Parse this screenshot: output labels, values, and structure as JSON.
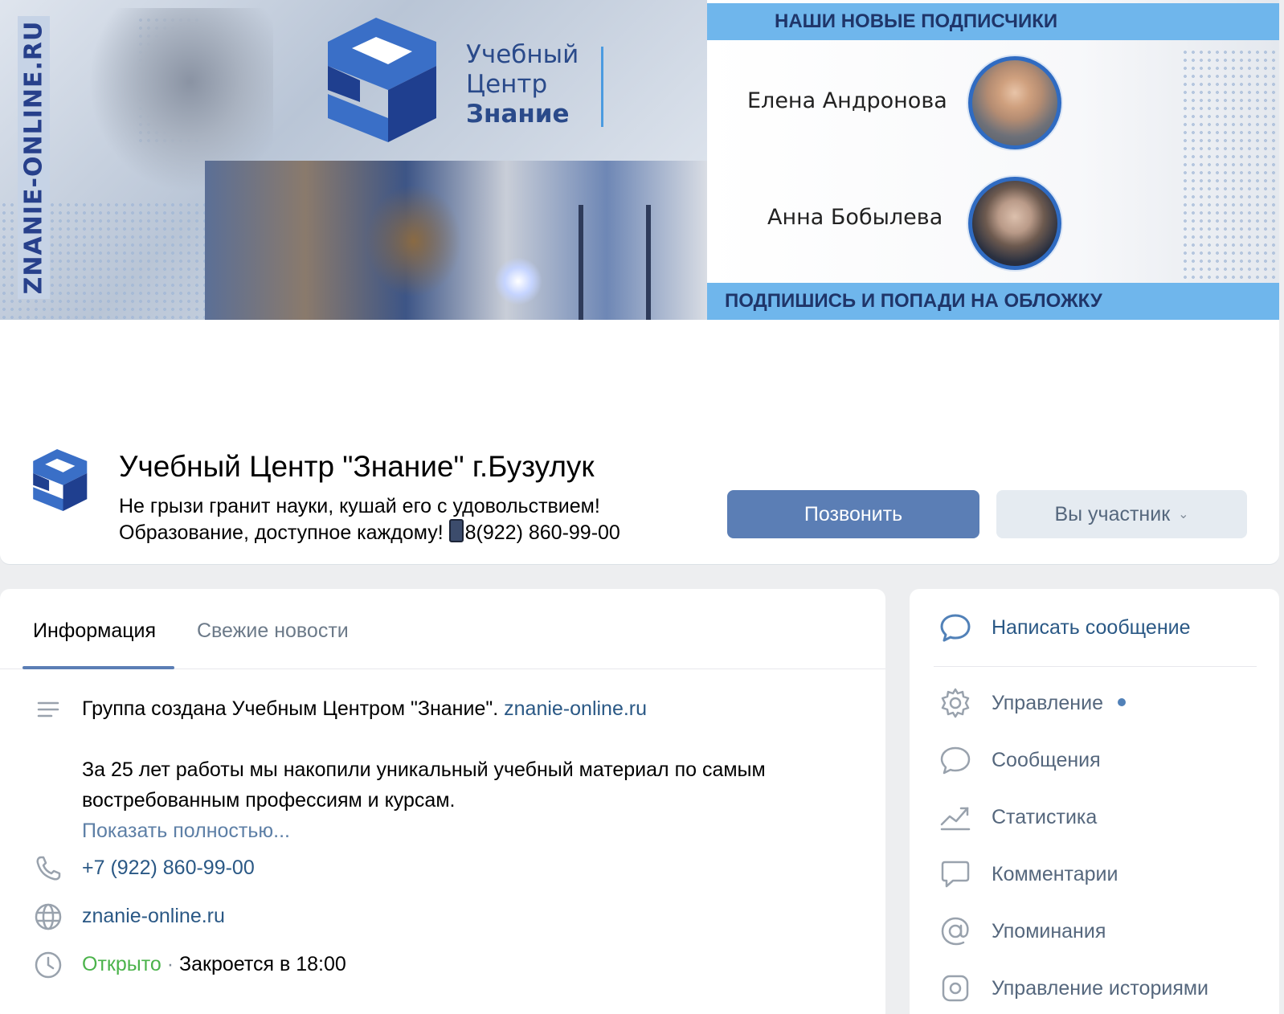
{
  "cover": {
    "vertical_text": "ZNANIE-ONLINE.RU",
    "logo_line1": "Учебный",
    "logo_line2": "Центр",
    "logo_line3": "Знание",
    "banner_top": "НАШИ НОВЫЕ ПОДПИСЧИКИ",
    "banner_bottom": "ПОДПИШИСЬ И ПОПАДИ НА ОБЛОЖКУ",
    "subscribers": [
      {
        "name": "Елена Андронова"
      },
      {
        "name": "Анна Бобылева"
      }
    ]
  },
  "group": {
    "title": "Учебный Центр \"Знание\" г.Бузулук",
    "status_line1": "Не грызи гранит науки, кушай его с удовольствием!",
    "status_line2_prefix": "Образование, доступное каждому!",
    "status_line2_phone": "8(922) 860-99-00",
    "call_button": "Позвонить",
    "member_button": "Вы участник"
  },
  "tabs": {
    "info": "Информация",
    "news": "Свежие новости"
  },
  "info": {
    "description_text": "Группа создана Учебным Центром \"Знание\".",
    "description_link": "znanie-online.ru",
    "description_line2": "За 25 лет работы мы накопили уникальный учебный материал по самым",
    "description_line3": "востребованным профессиям и курсам.",
    "show_more": "Показать полностью...",
    "phone": "+7 (922) 860-99-00",
    "website": "znanie-online.ru",
    "open_status": "Открыто",
    "separator": "·",
    "closes": "Закроется в 18:00"
  },
  "sidebar": {
    "write_message": "Написать сообщение",
    "items": [
      {
        "label": "Управление",
        "icon": "gear-icon"
      },
      {
        "label": "Сообщения",
        "icon": "chat-bubble-icon"
      },
      {
        "label": "Статистика",
        "icon": "chart-trend-icon"
      },
      {
        "label": "Комментарии",
        "icon": "comment-icon"
      },
      {
        "label": "Упоминания",
        "icon": "at-icon"
      },
      {
        "label": "Управление историями",
        "icon": "stories-icon"
      }
    ]
  },
  "colors": {
    "accent": "#5b7eb5",
    "link": "#2a5885",
    "open_green": "#4bb34b",
    "banner_blue": "#6fb6ec",
    "page_bg": "#edeef0"
  }
}
